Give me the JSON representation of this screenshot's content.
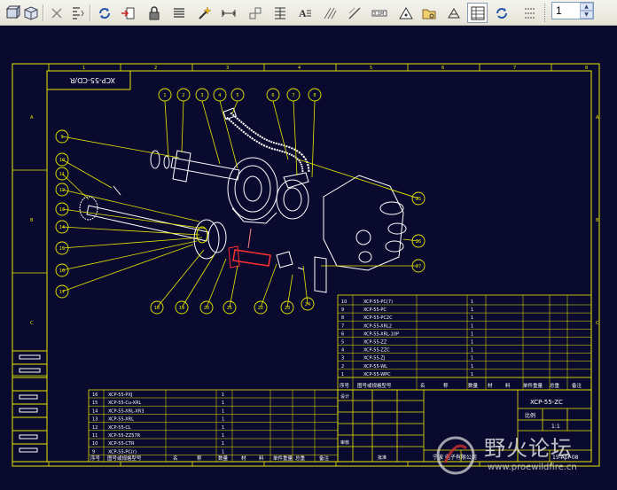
{
  "toolbar": {
    "buttons": [
      "3d-box-icon",
      "cube-icon",
      "cut-icon",
      "align-icon",
      "refresh-icon",
      "insert-icon",
      "lock-icon",
      "list-icon",
      "wand-icon",
      "dimension-icon",
      "stack-icon",
      "table-icon",
      "text-style-icon",
      "hatch-icon",
      "slash-icon",
      "ruler-icon",
      "note-icon",
      "folder-icon",
      "datum-icon",
      "grid-icon",
      "refresh-alt-icon",
      "options-icon"
    ],
    "spin_value": "1"
  },
  "drawing": {
    "title_box": "XCP-55-CD/R",
    "zone_numbers": [
      "1",
      "2",
      "3",
      "4",
      "5",
      "6",
      "7",
      "8"
    ],
    "zone_letters": [
      "A",
      "B",
      "C"
    ],
    "callouts": [
      "1",
      "2",
      "3",
      "4",
      "5",
      "6",
      "7",
      "8",
      "9",
      "10",
      "11",
      "12",
      "13",
      "14",
      "15",
      "16",
      "17",
      "18",
      "19",
      "20",
      "21",
      "22",
      "23",
      "24",
      "25",
      "26",
      "27"
    ],
    "bom_right": {
      "rows": [
        [
          "10",
          "XCP-55-PC(7)",
          "1"
        ],
        [
          "9",
          "XCP-55-PC",
          "1"
        ],
        [
          "8",
          "XCP-55-PC2C",
          "1"
        ],
        [
          "7",
          "XCP-55-XRL2",
          "1"
        ],
        [
          "6",
          "XCP-55-XRL-10P",
          "1"
        ],
        [
          "5",
          "XCP-55-ZZ",
          "1"
        ],
        [
          "4",
          "XCP-55-ZZC",
          "1"
        ],
        [
          "3",
          "XCP-55-ZJ",
          "1"
        ],
        [
          "2",
          "XCP-55-WL",
          "1"
        ],
        [
          "1",
          "XCP-55-WPC",
          "1"
        ]
      ],
      "header": [
        "序号",
        "图号或规格型号",
        "名",
        "称",
        "数量",
        "材",
        "料",
        "单件重量",
        "总重",
        "备注"
      ]
    },
    "bom_left": {
      "rows": [
        [
          "16",
          "XCP-55-PXJ",
          "1"
        ],
        [
          "15",
          "XCP-55-Cu-XRL",
          "1"
        ],
        [
          "14",
          "XCP-55-XRL-XR3",
          "1"
        ],
        [
          "13",
          "XCP-55-XRL",
          "1"
        ],
        [
          "12",
          "XCP-55-CL",
          "1"
        ],
        [
          "11",
          "XCP-55-ZZ57R",
          "1"
        ],
        [
          "10",
          "XCP-55-CTR",
          "1"
        ],
        [
          "9",
          "XCP-55-PC(r)",
          "1"
        ]
      ],
      "header": [
        "序号",
        "图号或规格型号",
        "名",
        "称",
        "数量",
        "材",
        "料",
        "单件重量",
        "总重",
        "备注"
      ]
    },
    "title_block": {
      "drawing_no": "XCP-55-ZC",
      "company": "宁波   电子有限公司",
      "scale_label": "比例",
      "date": "15-Apr-08",
      "design_label": "设计",
      "check_label": "审核",
      "approve_label": "批准",
      "qty": "1:1"
    }
  },
  "watermark": {
    "text": "野火论坛",
    "url": "www.proewildfire.cn"
  },
  "colors": {
    "background": "#0a0a2e",
    "frame": "#e8e800",
    "lines": "#ffffff",
    "accent": "#ff3030"
  }
}
